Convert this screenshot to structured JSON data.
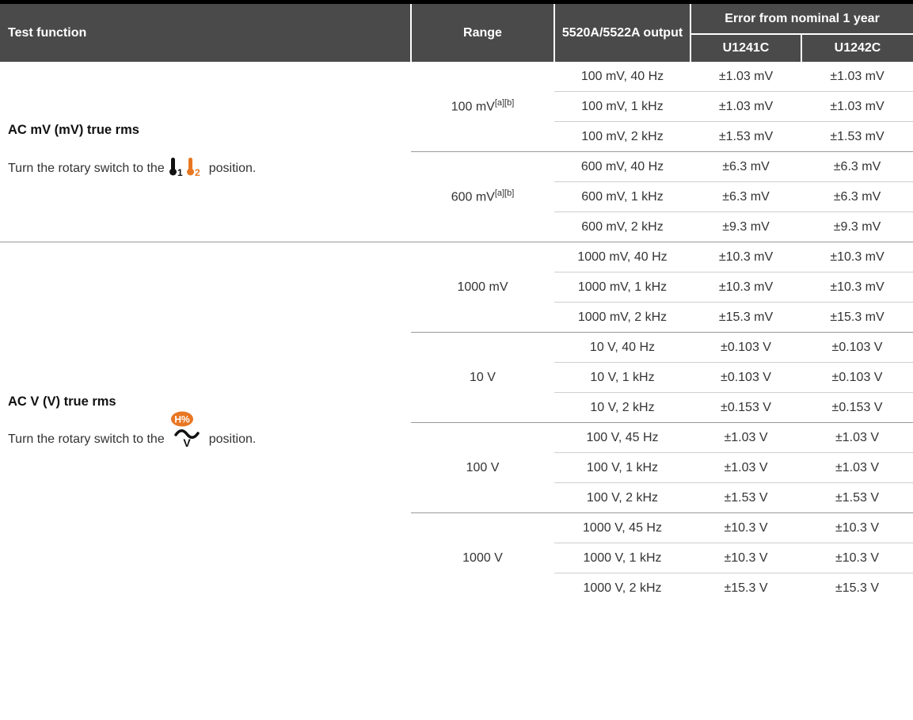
{
  "header": {
    "test_function": "Test function",
    "range": "Range",
    "output": "5520A/5522A output",
    "error": "Error from nominal 1 year",
    "model1": "U1241C",
    "model2": "U1242C"
  },
  "sections": [
    {
      "title": "AC mV (mV) true rms",
      "desc_before": "Turn the rotary switch to the",
      "desc_after": "position.",
      "icon": "temperature-t1-t2-icon",
      "groups": [
        {
          "range": "100 mV",
          "range_sup": "[a][b]",
          "rows": [
            {
              "output": "100 mV, 40 Hz",
              "e1": "±1.03 mV",
              "e2": "±1.03 mV"
            },
            {
              "output": "100 mV, 1 kHz",
              "e1": "±1.03 mV",
              "e2": "±1.03 mV"
            },
            {
              "output": "100 mV, 2 kHz",
              "e1": "±1.53 mV",
              "e2": "±1.53 mV"
            }
          ]
        },
        {
          "range": "600 mV",
          "range_sup": "[a][b]",
          "rows": [
            {
              "output": "600 mV, 40 Hz",
              "e1": "±6.3 mV",
              "e2": "±6.3 mV"
            },
            {
              "output": "600 mV, 1 kHz",
              "e1": "±6.3 mV",
              "e2": "±6.3 mV"
            },
            {
              "output": "600 mV, 2 kHz",
              "e1": "±9.3 mV",
              "e2": "±9.3 mV"
            }
          ]
        }
      ]
    },
    {
      "title": "AC V (V) true rms",
      "desc_before": "Turn the rotary switch to the",
      "desc_after": "position.",
      "icon": "ac-voltage-hz-percent-icon",
      "groups": [
        {
          "range": "1000 mV",
          "range_sup": "",
          "rows": [
            {
              "output": "1000 mV, 40 Hz",
              "e1": "±10.3 mV",
              "e2": "±10.3 mV"
            },
            {
              "output": "1000 mV, 1 kHz",
              "e1": "±10.3 mV",
              "e2": "±10.3 mV"
            },
            {
              "output": "1000 mV, 2 kHz",
              "e1": "±15.3 mV",
              "e2": "±15.3 mV"
            }
          ]
        },
        {
          "range": "10 V",
          "range_sup": "",
          "rows": [
            {
              "output": "10 V, 40 Hz",
              "e1": "±0.103 V",
              "e2": "±0.103 V"
            },
            {
              "output": "10 V, 1 kHz",
              "e1": "±0.103 V",
              "e2": "±0.103 V"
            },
            {
              "output": "10 V, 2 kHz",
              "e1": "±0.153 V",
              "e2": "±0.153 V"
            }
          ]
        },
        {
          "range": "100 V",
          "range_sup": "",
          "rows": [
            {
              "output": "100 V, 45 Hz",
              "e1": "±1.03 V",
              "e2": "±1.03 V"
            },
            {
              "output": "100 V, 1 kHz",
              "e1": "±1.03 V",
              "e2": "±1.03 V"
            },
            {
              "output": "100 V, 2 kHz",
              "e1": "±1.53 V",
              "e2": "±1.53 V"
            }
          ]
        },
        {
          "range": "1000 V",
          "range_sup": "",
          "rows": [
            {
              "output": "1000 V, 45 Hz",
              "e1": "±10.3 V",
              "e2": "±10.3 V"
            },
            {
              "output": "1000 V, 1 kHz",
              "e1": "±10.3 V",
              "e2": "±10.3 V"
            },
            {
              "output": "1000 V, 2 kHz",
              "e1": "±15.3 V",
              "e2": "±15.3 V"
            }
          ]
        }
      ]
    }
  ],
  "icon_text": {
    "hz_percent": "H%",
    "sub1": "1",
    "sub2": "2",
    "v": "V"
  },
  "colors": {
    "header_bg": "#4a4a4a",
    "accent_orange": "#e87722",
    "rule": "#9a9a9a"
  }
}
